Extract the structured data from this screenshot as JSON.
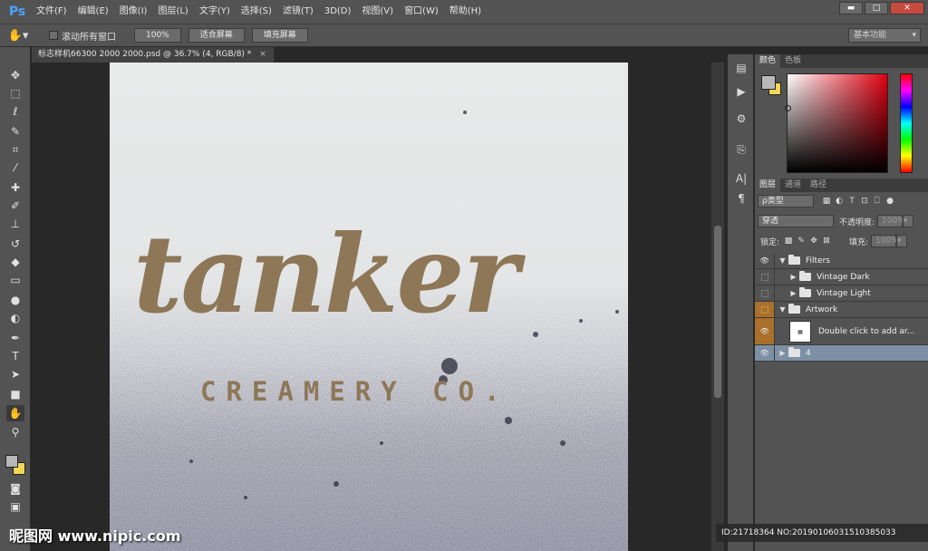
{
  "app": {
    "logo": "Ps",
    "menu": [
      "文件(F)",
      "编辑(E)",
      "图像(I)",
      "图层(L)",
      "文字(Y)",
      "选择(S)",
      "滤镜(T)",
      "3D(D)",
      "视图(V)",
      "窗口(W)",
      "帮助(H)"
    ],
    "window_controls": {
      "minimize": "▬",
      "maximize": "□",
      "close": "✕"
    }
  },
  "options_bar": {
    "scroll_all_label": "滚动所有窗口",
    "zoom_100": "100%",
    "fit_screen": "适合屏幕",
    "fill_screen": "填充屏幕",
    "workspace": "基本功能"
  },
  "document": {
    "tab_title": "标志样机66300 2000 2000.psd @ 36.7% (4, RGB/8) *",
    "tab_close": "×"
  },
  "canvas_art": {
    "logo_text": "tanker",
    "logo_subtitle": "CREAMERY CO."
  },
  "tools": [
    "move-tool",
    "marquee-tool",
    "lasso-tool",
    "quick-select-tool",
    "crop-tool",
    "eyedropper-tool",
    "healing-tool",
    "brush-tool",
    "stamp-tool",
    "history-brush-tool",
    "eraser-tool",
    "gradient-tool",
    "blur-tool",
    "dodge-tool",
    "pen-tool",
    "type-tool",
    "path-select-tool",
    "rectangle-tool",
    "hand-tool",
    "zoom-tool"
  ],
  "color_panel": {
    "tabs": [
      "颜色",
      "色板"
    ],
    "foreground": "#b8b8b8",
    "background": "#f2d556"
  },
  "layers_panel": {
    "tabs": [
      "图层",
      "通道",
      "路径"
    ],
    "filter_kind": "ρ类型",
    "blend_mode": "穿透",
    "opacity_label": "不透明度:",
    "opacity_value": "100%",
    "lock_label": "锁定:",
    "fill_label": "填充:",
    "fill_value": "100%",
    "layers": [
      {
        "name": "Filters",
        "type": "group",
        "expanded": true,
        "visible": true,
        "indent": 0
      },
      {
        "name": "Vintage Dark",
        "type": "group",
        "expanded": false,
        "visible": false,
        "indent": 1
      },
      {
        "name": "Vintage Light",
        "type": "group",
        "expanded": false,
        "visible": false,
        "indent": 1
      },
      {
        "name": "Artwork",
        "type": "group",
        "expanded": true,
        "visible": false,
        "indent": 0
      },
      {
        "name": "Double click to add ar...",
        "type": "smart",
        "visible": true,
        "indent": 1
      },
      {
        "name": "4",
        "type": "group",
        "expanded": false,
        "visible": true,
        "selected": true,
        "indent": 0
      }
    ]
  },
  "watermark": "昵图网 www.nipic.com",
  "image_id": "ID:21718364 NO:20190106031510385033"
}
